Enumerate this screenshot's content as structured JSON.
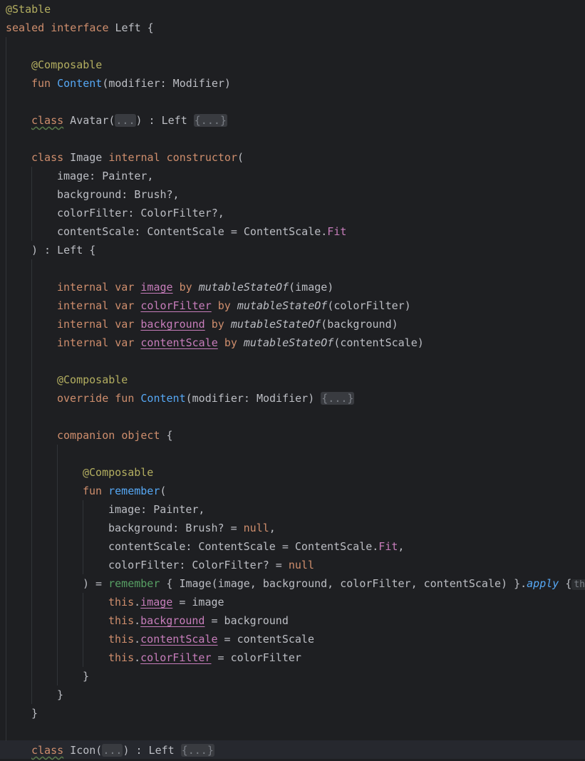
{
  "code": {
    "kw_sealed": "sealed",
    "kw_interface": "interface",
    "kw_fun": "fun",
    "kw_class": "class",
    "kw_internal": "internal",
    "kw_constructor": "constructor",
    "kw_var": "var",
    "kw_by": "by",
    "kw_override": "override",
    "kw_companion": "companion",
    "kw_object": "object",
    "kw_null": "null",
    "kw_this": "this",
    "ann_stable": "@Stable",
    "ann_composable": "@Composable",
    "t_left_open": " Left {",
    "fn_content": "Content",
    "t_modifier_param": "(modifier: Modifier)",
    "t_avatar": " Avatar(",
    "fold_params": "...",
    "t_colon_left": ") : Left ",
    "fold_body": "{...}",
    "t_image_cls": " Image ",
    "t_paren_open": "(",
    "t_p_image": "image: Painter,",
    "t_p_background": "background: Brush?,",
    "t_p_colorfilter": "colorFilter: ColorFilter?,",
    "t_p_contentscale_a": "contentScale: ContentScale = ContentScale.",
    "prop_fit": "Fit",
    "t_close_left": ") : Left {",
    "prop_image": "image",
    "prop_colorfilter": "colorFilter",
    "prop_background": "background",
    "prop_contentscale": "contentScale",
    "fn_mutablestateof": "mutableStateOf",
    "t_arg_image": "(image)",
    "t_arg_colorfilter": "(colorFilter)",
    "t_arg_background": "(background)",
    "t_arg_contentscale": "(contentScale)",
    "t_sp": " ",
    "t_modifier_param_sp": "(modifier: Modifier) ",
    "t_brace_open": " {",
    "fn_remember": "remember",
    "t_p_background_null": "background: Brush? = ",
    "t_comma": ",",
    "t_p_contentscale_b": "contentScale: ContentScale = ContentScale.",
    "t_p_colorfilter_null": "colorFilter: ColorFilter? = ",
    "t_eq_close": ") = ",
    "fn_remember_call": "remember",
    "t_remember_body": " { Image(image, background, colorFilter, contentScale) }.",
    "fn_apply": "apply",
    "hint_this": "th",
    "t_dot": ".",
    "t_eq_image": " = image",
    "t_eq_background": " = background",
    "t_eq_contentscale": " = contentScale",
    "t_eq_colorfilter": " = colorFilter",
    "t_brace_close": "}",
    "t_icon": " Icon("
  }
}
